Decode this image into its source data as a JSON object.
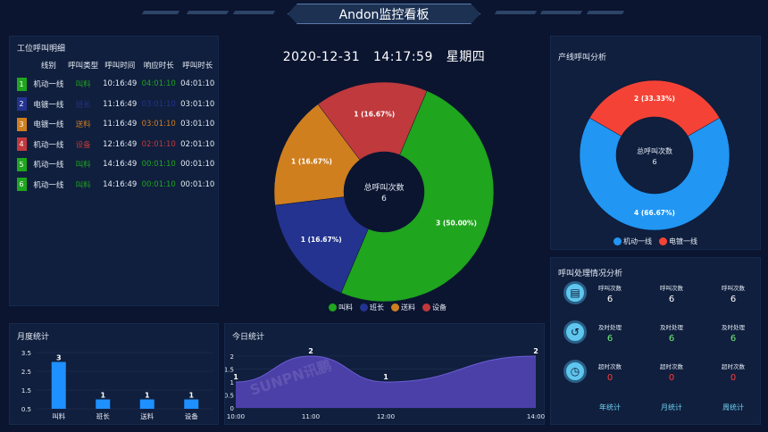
{
  "header": {
    "title": "Andon监控看板"
  },
  "datetime": {
    "date": "2020-12-31",
    "time": "14:17:59",
    "weekday": "星期四"
  },
  "call_detail": {
    "title": "工位呼叫明细",
    "columns": [
      "线别",
      "呼叫类型",
      "呼叫时间",
      "响应时长",
      "呼叫时长"
    ],
    "rows": [
      {
        "index": "1",
        "line": "机动一线",
        "type": "叫料",
        "time": "10:16:49",
        "response": "04:01:10",
        "duration": "04:01:10",
        "color": "#1fa51e"
      },
      {
        "index": "2",
        "line": "电镀一线",
        "type": "班长",
        "time": "11:16:49",
        "response": "03:01:10",
        "duration": "03:01:10",
        "color": "#23338f"
      },
      {
        "index": "3",
        "line": "电镀一线",
        "type": "送料",
        "time": "11:16:49",
        "response": "03:01:10",
        "duration": "03:01:10",
        "color": "#d07f1f"
      },
      {
        "index": "4",
        "line": "机动一线",
        "type": "设备",
        "time": "12:16:49",
        "response": "02:01:10",
        "duration": "02:01:10",
        "color": "#c0393c"
      },
      {
        "index": "5",
        "line": "机动一线",
        "type": "叫料",
        "time": "14:16:49",
        "response": "00:01:10",
        "duration": "00:01:10",
        "color": "#1fa51e"
      },
      {
        "index": "6",
        "line": "机动一线",
        "type": "叫料",
        "time": "14:16:49",
        "response": "00:01:10",
        "duration": "00:01:10",
        "color": "#1fa51e"
      }
    ]
  },
  "chart_data": [
    {
      "type": "pie",
      "center_label": "总呼叫次数",
      "center_value": "6",
      "slices": [
        {
          "name": "叫料",
          "value": 3,
          "label": "3 (50.00%)",
          "color": "#1fa51e"
        },
        {
          "name": "班长",
          "value": 1,
          "label": "1 (16.67%)",
          "color": "#23338f"
        },
        {
          "name": "送料",
          "value": 1,
          "label": "1 (16.67%)",
          "color": "#d07f1f"
        },
        {
          "name": "设备",
          "value": 1,
          "label": "1 (16.67%)",
          "color": "#c0393c"
        }
      ]
    },
    {
      "type": "pie",
      "title": "产线呼叫分析",
      "center_label": "总呼叫次数",
      "center_value": "6",
      "slices": [
        {
          "name": "机动一线",
          "value": 4,
          "label": "4 (66.67%)",
          "color": "#2196f3"
        },
        {
          "name": "电镀一线",
          "value": 2,
          "label": "2 (33.33%)",
          "color": "#f44336"
        }
      ]
    },
    {
      "type": "bar",
      "title": "月度统计",
      "categories": [
        "叫料",
        "班长",
        "送料",
        "设备"
      ],
      "values": [
        3,
        1,
        1,
        1
      ],
      "yticks": [
        "3.5",
        "2.5",
        "1.5",
        "0.5"
      ],
      "ylim": [
        0.5,
        3.5
      ],
      "color": "#1e90ff"
    },
    {
      "type": "area",
      "title": "今日统计",
      "x": [
        "10:00",
        "11:00",
        "12:00",
        "14:00"
      ],
      "points": [
        {
          "x": "10:00",
          "y": 1
        },
        {
          "x": "11:00",
          "y": 2
        },
        {
          "x": "12:00",
          "y": 1
        },
        {
          "x": "14:00",
          "y": 2
        }
      ],
      "yticks": [
        "2",
        "1.5",
        "1",
        "0.5",
        "0"
      ],
      "ylim": [
        0,
        2
      ],
      "color": "#4b3fa8"
    }
  ],
  "watermark": "SUNPN讯鹏",
  "handling": {
    "title": "呼叫处理情况分析",
    "rows": [
      {
        "icon": "document-icon",
        "cells": [
          {
            "label": "呼叫次数",
            "value": "6"
          },
          {
            "label": "呼叫次数",
            "value": "6"
          },
          {
            "label": "呼叫次数",
            "value": "6"
          }
        ],
        "color": "#ffffff"
      },
      {
        "icon": "history-icon",
        "cells": [
          {
            "label": "及时处理",
            "value": "6"
          },
          {
            "label": "及时处理",
            "value": "6"
          },
          {
            "label": "及时处理",
            "value": "6"
          }
        ],
        "color": "#6ff07a"
      },
      {
        "icon": "clock-alert-icon",
        "cells": [
          {
            "label": "超时次数",
            "value": "0"
          },
          {
            "label": "超时次数",
            "value": "0"
          },
          {
            "label": "超时次数",
            "value": "0"
          }
        ],
        "color": "#ff3b3b"
      }
    ],
    "links": [
      "年统计",
      "月统计",
      "周统计"
    ]
  }
}
